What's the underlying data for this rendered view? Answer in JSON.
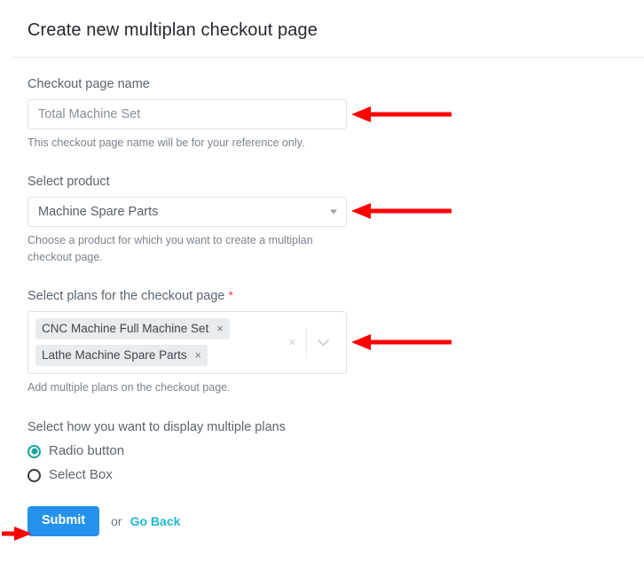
{
  "header": {
    "title": "Create new multiplan checkout page"
  },
  "form": {
    "checkout_name": {
      "label": "Checkout page name",
      "value": "Total Machine Set",
      "placeholder": "Total Machine Set",
      "helper": "This checkout page name will be for your reference only."
    },
    "product": {
      "label": "Select product",
      "selected": "Machine Spare Parts",
      "helper": "Choose a product for which you want to create a multiplan checkout page.",
      "caret_icon": "chevron-down-icon"
    },
    "plans": {
      "label": "Select plans for the checkout page",
      "required_marker": "*",
      "chips": [
        {
          "label": "CNC Machine Full Machine Set",
          "remove_icon": "×"
        },
        {
          "label": "Lathe Machine Spare Parts",
          "remove_icon": "×"
        }
      ],
      "clear_all_icon": "×",
      "dropdown_icon": "chevron-down-icon",
      "helper": "Add multiple plans on the checkout page."
    },
    "display_mode": {
      "label": "Select how you want to display multiple plans",
      "options": [
        {
          "label": "Radio button",
          "selected": true
        },
        {
          "label": "Select Box",
          "selected": false
        }
      ]
    }
  },
  "actions": {
    "submit_label": "Submit",
    "or_text": "or",
    "go_back_label": "Go Back"
  },
  "annotations": {
    "arrows": [
      {
        "name": "arrow-to-checkout-name-input",
        "direction": "left"
      },
      {
        "name": "arrow-to-product-select",
        "direction": "left"
      },
      {
        "name": "arrow-to-plans-multiselect",
        "direction": "left"
      },
      {
        "name": "arrow-to-submit-button",
        "direction": "right"
      }
    ],
    "color": "#FF0000"
  },
  "colors": {
    "accent_blue": "#2492ed",
    "link_cyan": "#1fb6d1",
    "radio_teal": "#17a398",
    "required_red": "#d9434e",
    "annotation_red": "#FF0000"
  }
}
